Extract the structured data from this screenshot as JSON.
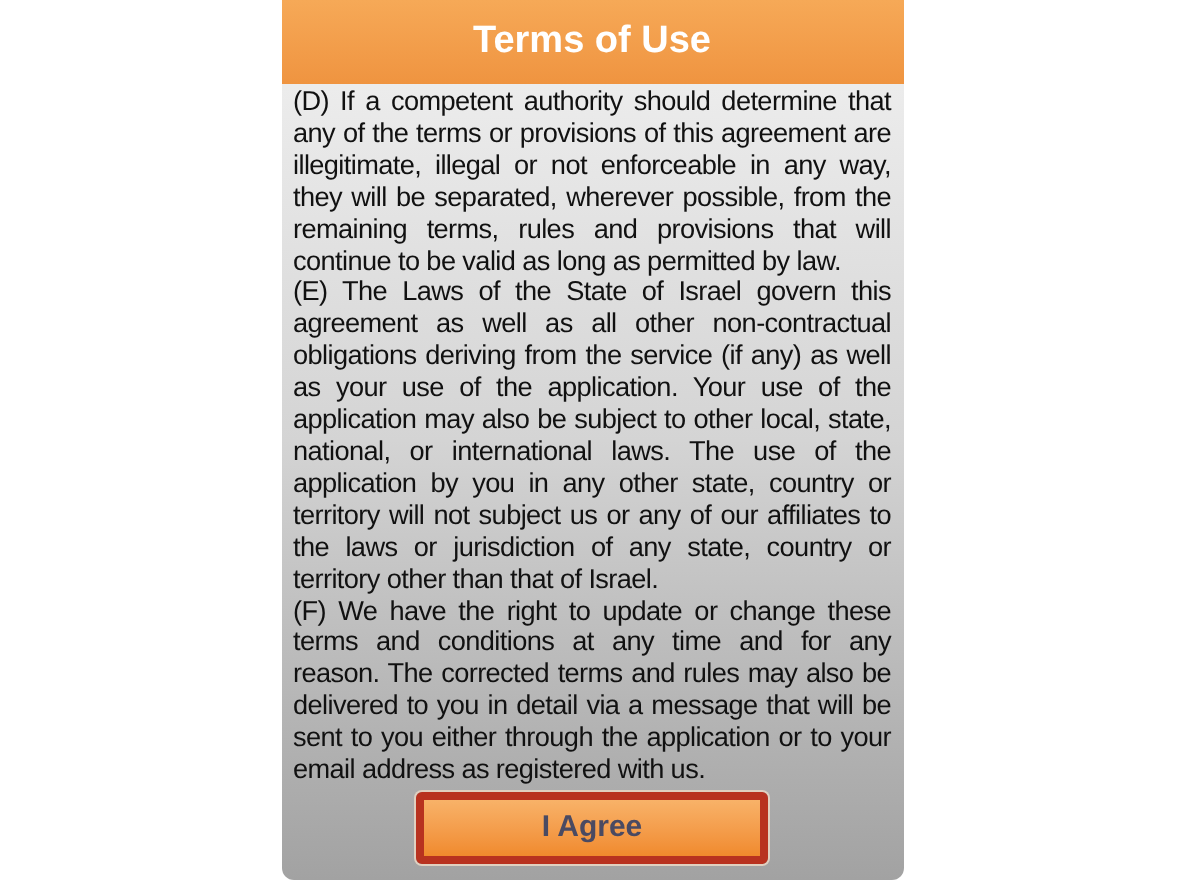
{
  "header": {
    "title": "Terms of Use"
  },
  "paragraphs": [
    "(D) If a competent authority should determine that any of the terms or provisions of this agreement are illegitimate, illegal or not enforceable in any way, they will be separated, wherever possible, from the remaining terms, rules and provisions that will continue to be valid as long as permitted by law.",
    "(E) The Laws of the State of Israel govern this agreement as well as all other non-contractual obligations deriving from the service (if any) as well as your use of the application. Your use of the application may also be subject to other local, state, national, or international laws. The use of the application by you in any other state, country or territory will not subject us or any of our affiliates to the laws or jurisdiction of any state, country or territory other than that of Israel.",
    "(F) We have the right to update or change these terms and conditions at any time and for any reason. The corrected terms and rules may also be delivered to you in detail via a message that will be sent to you either through the application or to your email address as registered with us."
  ],
  "button": {
    "label": "I Agree"
  }
}
